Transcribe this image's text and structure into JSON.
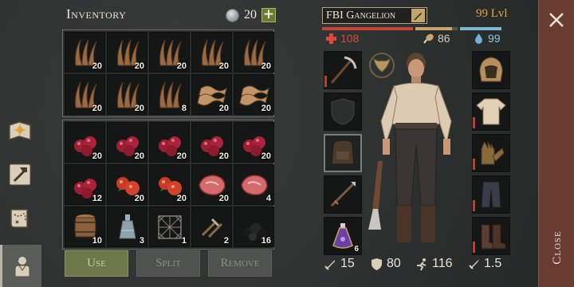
{
  "inventory": {
    "title": "Inventory",
    "coins": "20",
    "add_label": "+",
    "slots_top": [
      {
        "item": "straw",
        "qty": "20"
      },
      {
        "item": "straw",
        "qty": "20"
      },
      {
        "item": "straw",
        "qty": "20"
      },
      {
        "item": "straw",
        "qty": "20"
      },
      {
        "item": "straw",
        "qty": "20"
      },
      {
        "item": "straw",
        "qty": "20"
      },
      {
        "item": "straw",
        "qty": "20"
      },
      {
        "item": "straw",
        "qty": "8"
      },
      {
        "item": "rope-fiber",
        "qty": "20"
      },
      {
        "item": "rope-fiber",
        "qty": "20"
      }
    ],
    "slots_bottom": [
      {
        "item": "berries",
        "qty": "20"
      },
      {
        "item": "berries",
        "qty": "20"
      },
      {
        "item": "berries",
        "qty": "20"
      },
      {
        "item": "berries",
        "qty": "20"
      },
      {
        "item": "berries",
        "qty": "20"
      },
      {
        "item": "berries",
        "qty": "12"
      },
      {
        "item": "apples",
        "qty": "20"
      },
      {
        "item": "apples",
        "qty": "20"
      },
      {
        "item": "raw-meat",
        "qty": "20"
      },
      {
        "item": "raw-meat",
        "qty": "4"
      },
      {
        "item": "barrel",
        "qty": "10"
      },
      {
        "item": "bottle",
        "qty": "3"
      },
      {
        "item": "net",
        "qty": "1"
      },
      {
        "item": "nails",
        "qty": "2"
      },
      {
        "item": "coal",
        "qty": "16"
      }
    ],
    "buttons": {
      "use": "Use",
      "split": "Split",
      "remove": "Remove"
    }
  },
  "character": {
    "name": "FBI Gangelion",
    "level": "99 Lvl",
    "health": "108",
    "food": "86",
    "water": "99",
    "bars": [
      {
        "color": "#c8433a",
        "fill": 1.0
      },
      {
        "color": "#c9a46a",
        "fill": 0.87
      },
      {
        "color": "#7fb7d1",
        "fill": 1.0
      }
    ],
    "left_equip": [
      {
        "item": "pickaxe",
        "qty": ""
      },
      {
        "item": "shield",
        "qty": ""
      },
      {
        "item": "backpack",
        "qty": ""
      },
      {
        "item": "spear",
        "qty": ""
      },
      {
        "item": "potion",
        "qty": "6"
      }
    ],
    "right_equip": [
      {
        "item": "hood",
        "qty": ""
      },
      {
        "item": "shirt",
        "qty": ""
      },
      {
        "item": "gloves",
        "qty": ""
      },
      {
        "item": "pants",
        "qty": ""
      },
      {
        "item": "boots",
        "qty": ""
      }
    ],
    "stats": {
      "attack": "15",
      "defense": "80",
      "speed": "116",
      "weight": "1.5"
    }
  },
  "close": {
    "label": "Close"
  },
  "colors": {
    "health": "#e0473a",
    "food": "#caa26b",
    "water": "#6ab2d6",
    "level": "#e0a73c",
    "close_bg": "#6a3b31"
  }
}
